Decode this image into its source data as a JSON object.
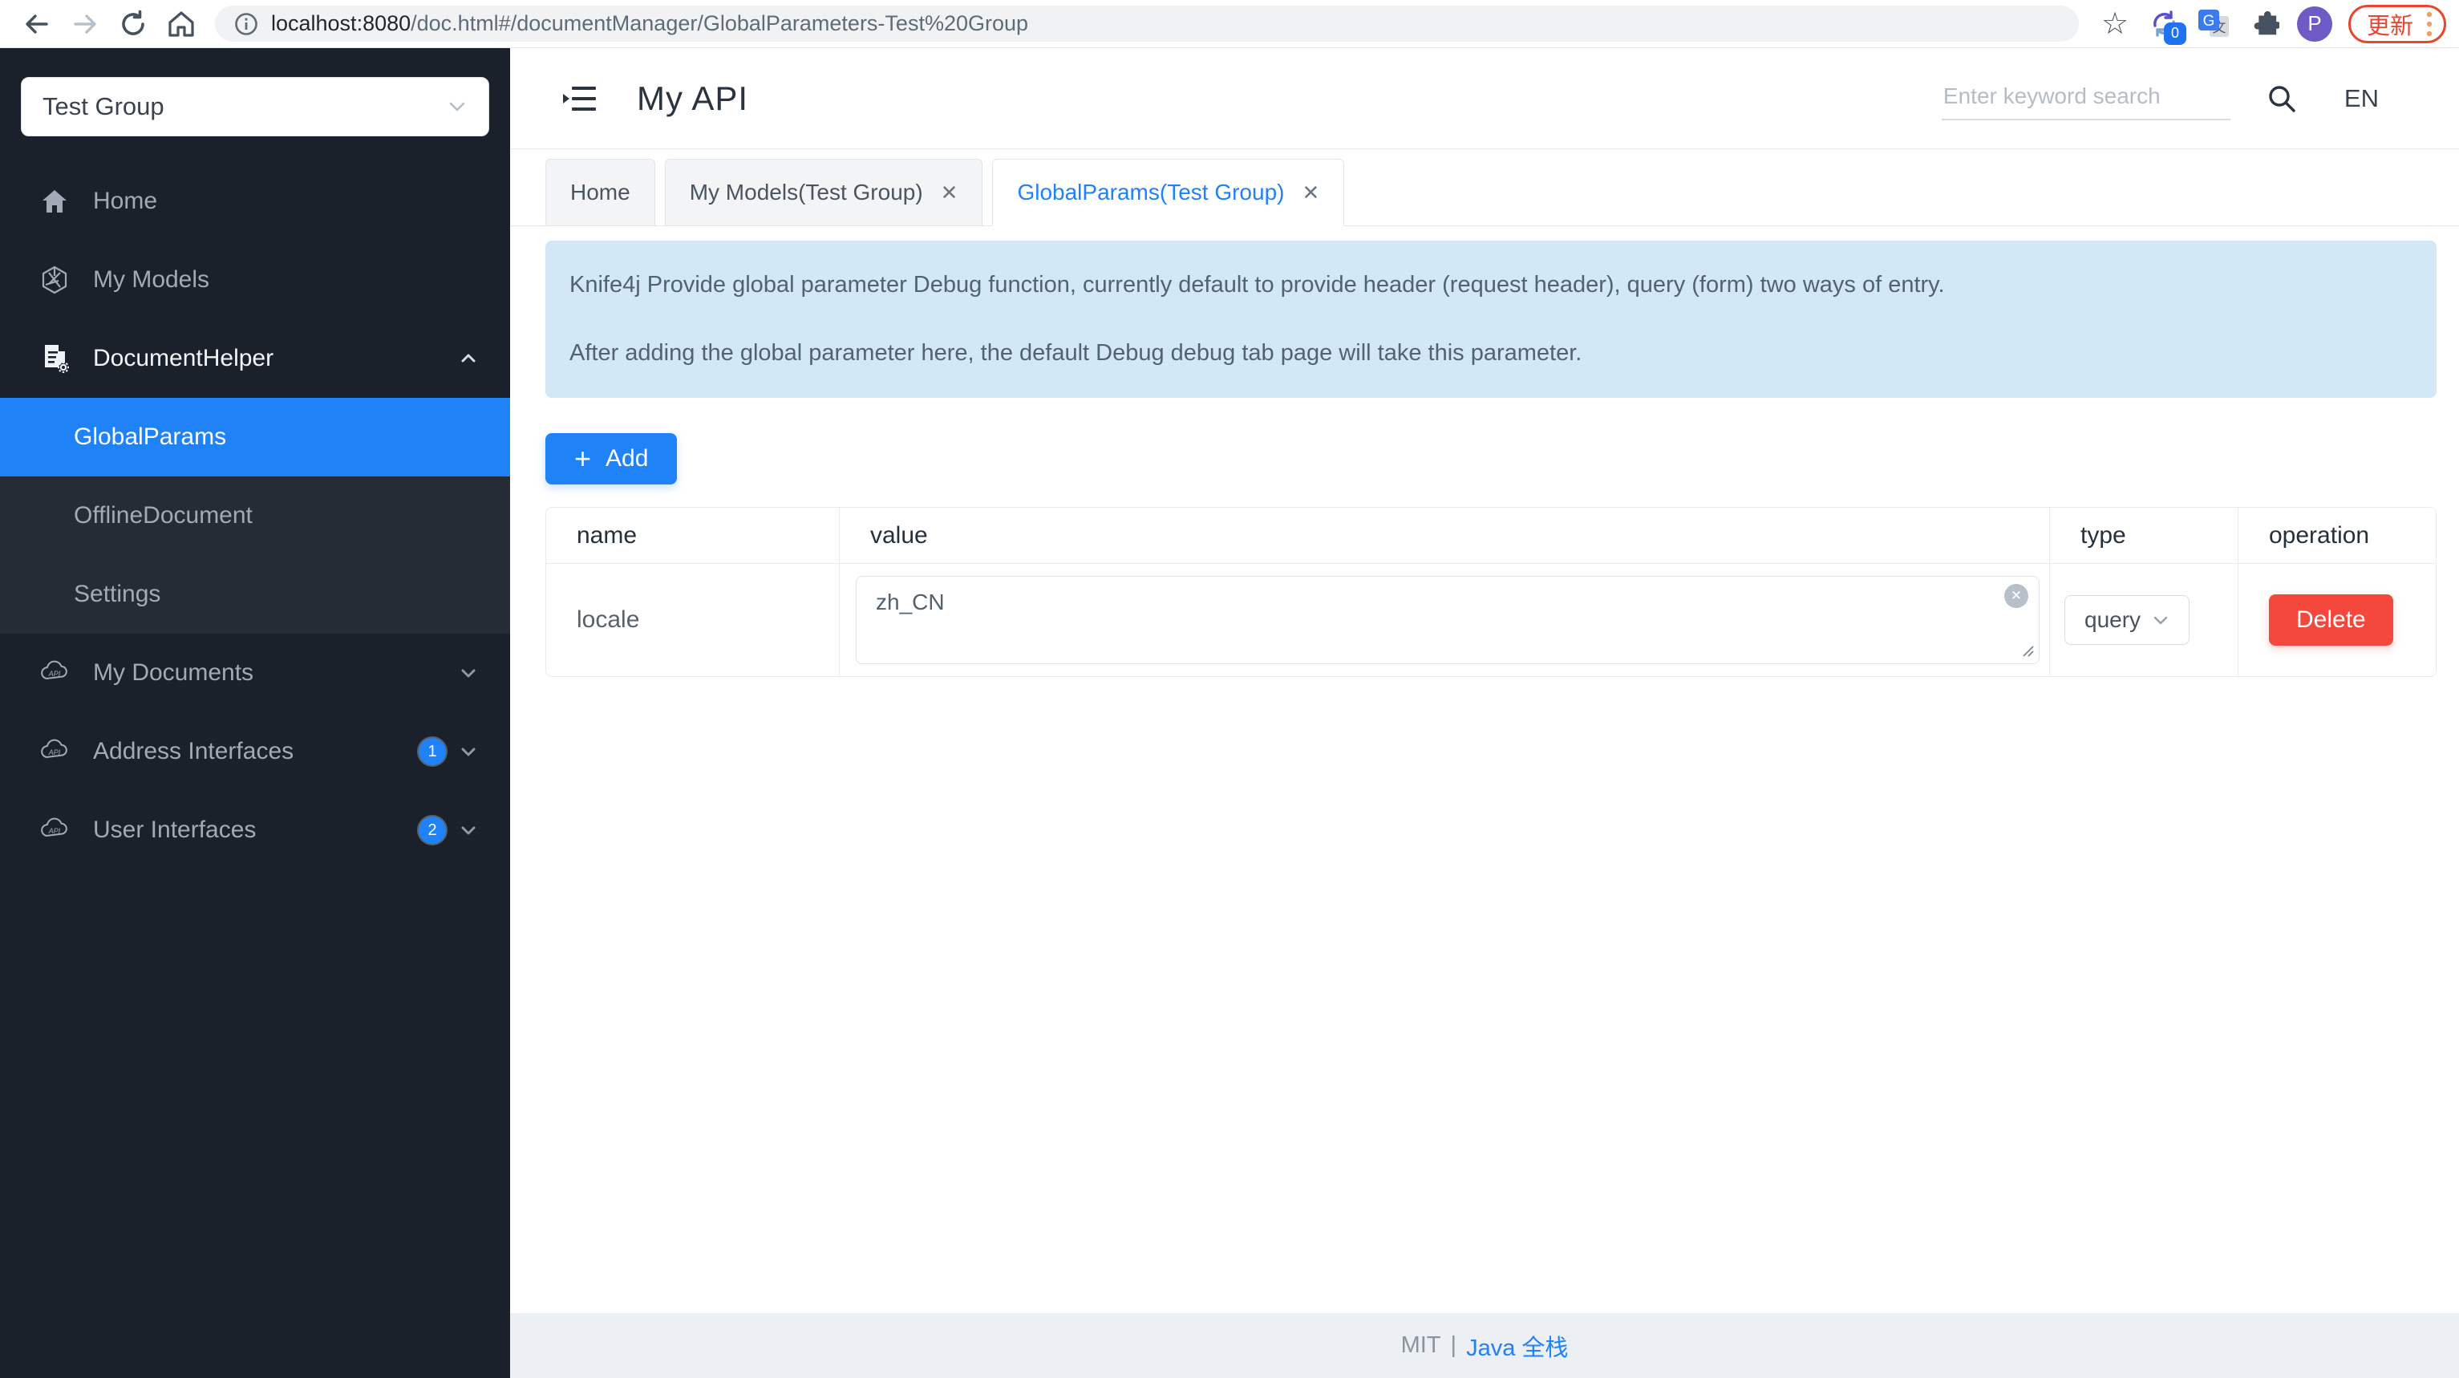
{
  "browser": {
    "url": {
      "host": "localhost:8080",
      "path": "/doc.html#/documentManager/GlobalParameters-Test%20Group"
    },
    "sync_badge": "0",
    "avatar_initial": "P",
    "update_label": "更新"
  },
  "sidebar": {
    "group_selector": {
      "value": "Test Group"
    },
    "menu": [
      {
        "label": "Home"
      },
      {
        "label": "My Models"
      },
      {
        "label": "DocumentHelper"
      },
      {
        "label": "My Documents"
      },
      {
        "label": "Address Interfaces",
        "badge": "1"
      },
      {
        "label": "User Interfaces",
        "badge": "2"
      }
    ],
    "document_helper_children": [
      {
        "label": "GlobalParams"
      },
      {
        "label": "OfflineDocument"
      },
      {
        "label": "Settings"
      }
    ]
  },
  "header": {
    "title": "My API",
    "search_placeholder": "Enter keyword search",
    "lang": "EN"
  },
  "tabs": [
    {
      "label": "Home"
    },
    {
      "label": "My Models(Test Group)"
    },
    {
      "label": "GlobalParams(Test Group)"
    }
  ],
  "banner": {
    "line1": "Knife4j Provide global parameter Debug function, currently default to provide header (request header), query (form) two ways of entry.",
    "line2": "After adding the global parameter here, the default Debug debug tab page will take this parameter."
  },
  "toolbar": {
    "add_label": "Add",
    "plus_glyph": "+"
  },
  "table": {
    "columns": [
      "name",
      "value",
      "type",
      "operation"
    ],
    "rows": [
      {
        "name": "locale",
        "value": "zh_CN",
        "type": "query",
        "operation": "Delete"
      }
    ]
  },
  "footer": {
    "license": "MIT",
    "separator": "|",
    "link": "Java 全栈"
  },
  "icons": {
    "close": "✕",
    "clear": "✕",
    "star": "☆"
  },
  "colors": {
    "primary": "#1f82f7",
    "danger": "#f4483c",
    "banner_bg": "#d2e8f7",
    "sidebar_bg": "#1b212b",
    "submenu_bg": "#262c36",
    "update_orange": "#e8472f",
    "avatar_purple": "#6f5bc5"
  }
}
